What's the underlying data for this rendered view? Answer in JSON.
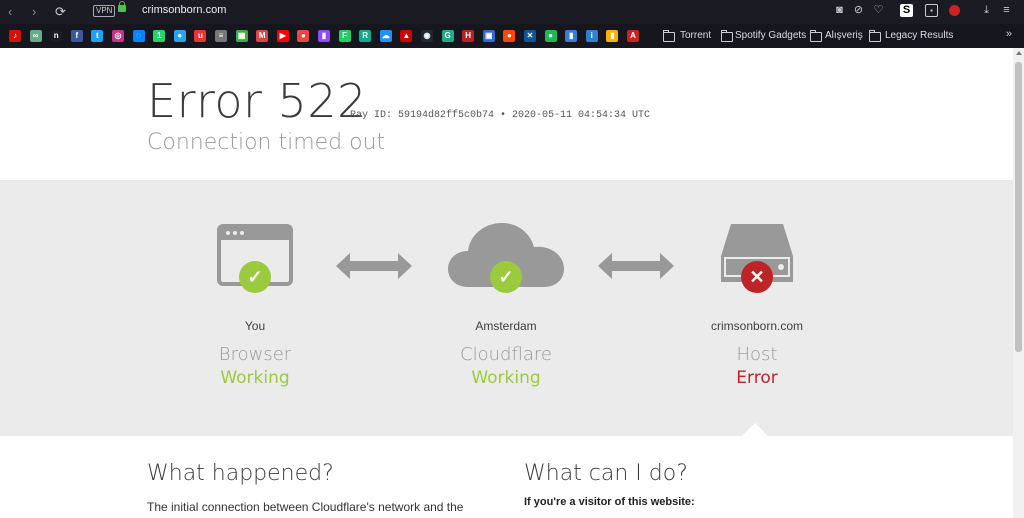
{
  "browser": {
    "vpn_label": "VPN",
    "url": "crimsonborn.com",
    "nav": {
      "back": "‹",
      "forward": "›",
      "reload": "⟳"
    },
    "toolbar_icons": [
      "camera-icon",
      "shield-block-icon",
      "heart-icon",
      "extension-s-icon",
      "extension-shield-icon",
      "extension-red-icon",
      "download-icon",
      "menu-icon"
    ],
    "bookmarks": {
      "folders": [
        {
          "label": "Torrent"
        },
        {
          "label": "Spotify Gadgets"
        },
        {
          "label": "Alışveriş"
        },
        {
          "label": "Legacy Results"
        }
      ],
      "more": "»",
      "site_icons": [
        {
          "name": "bookmark-lastfm-icon",
          "glyph": "♪",
          "color": "#d51007"
        },
        {
          "name": "bookmark-infinity-icon",
          "glyph": "∞",
          "color": "#6a8"
        },
        {
          "name": "bookmark-n-icon",
          "glyph": "n",
          "color": "#1b1b24"
        },
        {
          "name": "bookmark-facebook-icon",
          "glyph": "f",
          "color": "#3b5998"
        },
        {
          "name": "bookmark-twitter-icon",
          "glyph": "t",
          "color": "#1da1f2"
        },
        {
          "name": "bookmark-instagram-icon",
          "glyph": "◎",
          "color": "#c13584"
        },
        {
          "name": "bookmark-messenger-icon",
          "glyph": "◌",
          "color": "#0084ff"
        },
        {
          "name": "bookmark-whatsapp-icon",
          "glyph": "1",
          "color": "#25d366"
        },
        {
          "name": "bookmark-chat-icon",
          "glyph": "●",
          "color": "#2aa3ef"
        },
        {
          "name": "bookmark-u-icon",
          "glyph": "u",
          "color": "#e33"
        },
        {
          "name": "bookmark-cisco-icon",
          "glyph": "≡",
          "color": "#777"
        },
        {
          "name": "bookmark-gallery-icon",
          "glyph": "▦",
          "color": "#4a4"
        },
        {
          "name": "bookmark-gmail-icon",
          "glyph": "M",
          "color": "#d44"
        },
        {
          "name": "bookmark-youtube-icon",
          "glyph": "▶",
          "color": "#f00"
        },
        {
          "name": "bookmark-red-icon",
          "glyph": "●",
          "color": "#e44"
        },
        {
          "name": "bookmark-twitch-icon",
          "glyph": "▮",
          "color": "#9146ff"
        },
        {
          "name": "bookmark-f-icon",
          "glyph": "F",
          "color": "#2c6"
        },
        {
          "name": "bookmark-re-icon",
          "glyph": "R",
          "color": "#1a8"
        },
        {
          "name": "bookmark-cloud-icon",
          "glyph": "☁",
          "color": "#1e90ff"
        },
        {
          "name": "bookmark-tesla-icon",
          "glyph": "▲",
          "color": "#c00"
        },
        {
          "name": "bookmark-steam-icon",
          "glyph": "◉",
          "color": "#1b2838"
        },
        {
          "name": "bookmark-g-icon",
          "glyph": "G",
          "color": "#2a8"
        },
        {
          "name": "bookmark-h-icon",
          "glyph": "H",
          "color": "#b22"
        },
        {
          "name": "bookmark-image-icon",
          "glyph": "▣",
          "color": "#36c"
        },
        {
          "name": "bookmark-reddit-icon",
          "glyph": "●",
          "color": "#ff4500"
        },
        {
          "name": "bookmark-x-icon",
          "glyph": "✕",
          "color": "#159"
        },
        {
          "name": "bookmark-spotify-icon",
          "glyph": "●",
          "color": "#1db954"
        },
        {
          "name": "bookmark-blue-icon",
          "glyph": "▮",
          "color": "#3a7bd5"
        },
        {
          "name": "bookmark-itb-icon",
          "glyph": "i",
          "color": "#2f7fd0"
        },
        {
          "name": "bookmark-bars-icon",
          "glyph": "▮",
          "color": "#f4b400"
        },
        {
          "name": "bookmark-arch-icon",
          "glyph": "A",
          "color": "#c22"
        }
      ]
    }
  },
  "error": {
    "code": "Error 522",
    "ray": "Ray ID: 59194d82ff5c0b74 • 2020-05-11 04:54:34 UTC",
    "message": "Connection timed out"
  },
  "nodes": [
    {
      "location": "You",
      "type": "Browser",
      "status": "Working",
      "ok": true
    },
    {
      "location": "Amsterdam",
      "type": "Cloudflare",
      "status": "Working",
      "ok": true
    },
    {
      "location": "crimsonborn.com",
      "type": "Host",
      "status": "Error",
      "ok": false
    }
  ],
  "colors": {
    "working": "#9bca3e",
    "error": "#bd2426",
    "icon_gray": "#999999"
  },
  "sections": {
    "what_happened": {
      "title": "What happened?",
      "text": "The initial connection between Cloudflare's network and the"
    },
    "what_can_i_do": {
      "title": "What can I do?",
      "subtitle": "If you're a visitor of this website:"
    }
  }
}
